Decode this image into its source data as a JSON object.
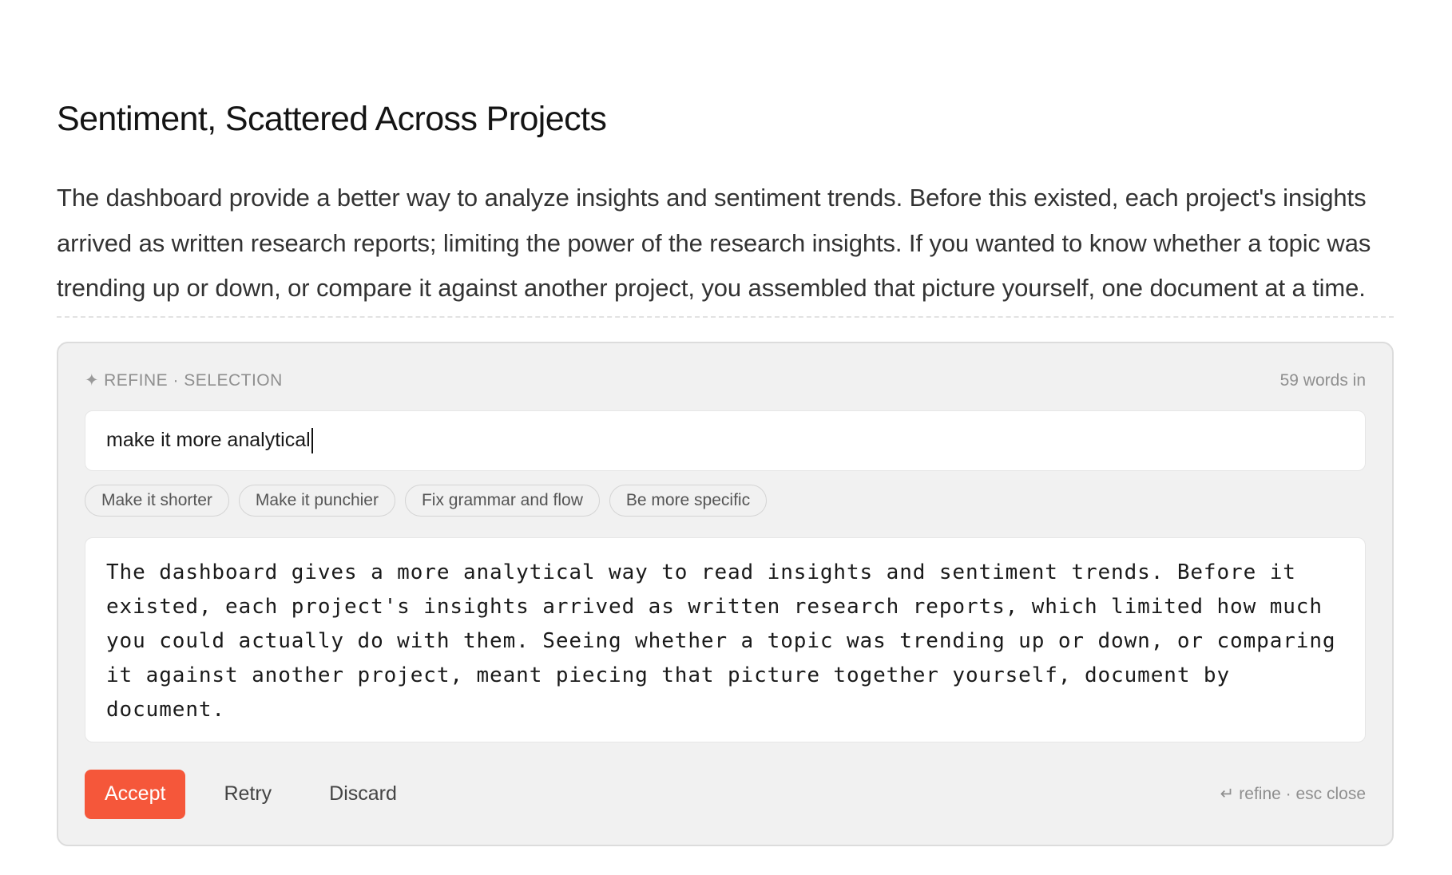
{
  "doc": {
    "title": "Sentiment, Scattered Across Projects",
    "paragraph": "The dashboard provide a better way to analyze insights and sentiment trends. Before this existed, each project's insights arrived as written research reports; limiting the power of the research insights. If you wanted to know whether a topic was trending up or down, or compare it against another project, you assembled that picture yourself, one document at a time."
  },
  "refine": {
    "header_icon": "sparkle-icon",
    "header_label": "REFINE · SELECTION",
    "word_count": "59 words in",
    "input_value": "make it more analytical",
    "input_placeholder": "",
    "chips": [
      {
        "label": "Make it shorter"
      },
      {
        "label": "Make it punchier"
      },
      {
        "label": "Fix grammar and flow"
      },
      {
        "label": "Be more specific"
      }
    ],
    "result_text": "The dashboard gives a more analytical way to read insights and sentiment trends. Before it existed, each project's insights arrived as written research reports, which limited how much you could actually do with them. Seeing whether a topic was trending up or down, or comparing it against another project, meant piecing that picture together yourself, document by document.",
    "actions": {
      "accept": "Accept",
      "retry": "Retry",
      "discard": "Discard"
    },
    "shortcut_icon": "enter-icon",
    "shortcut_hint": "refine · esc close"
  },
  "colors": {
    "accent": "#f5573a",
    "panel_bg": "#f1f1f1",
    "muted_text": "#8f8f8f"
  }
}
